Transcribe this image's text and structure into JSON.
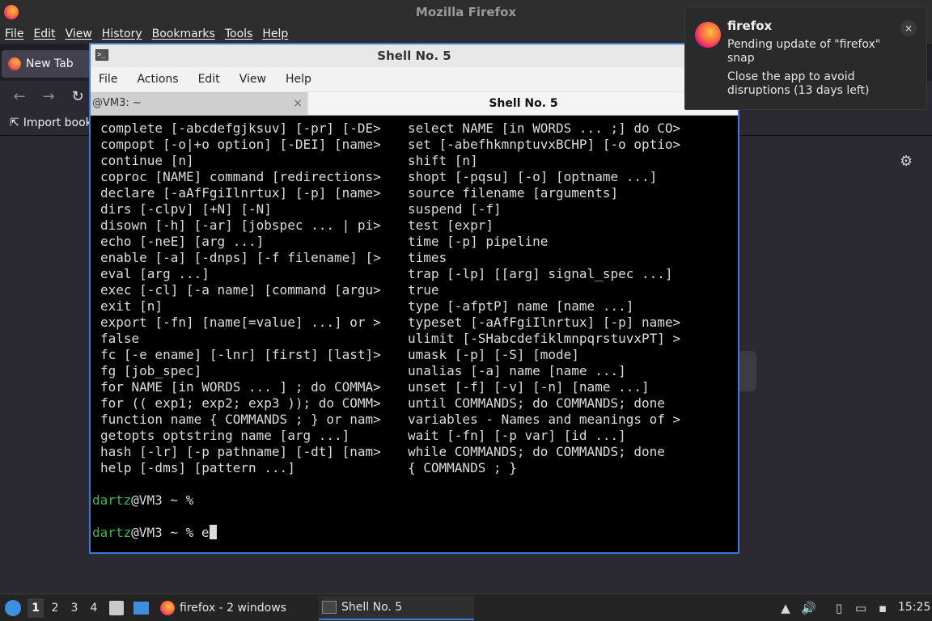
{
  "firefox": {
    "window_title": "Mozilla Firefox",
    "menu": [
      "File",
      "Edit",
      "View",
      "History",
      "Bookmarks",
      "Tools",
      "Help"
    ],
    "tab_label": "New Tab",
    "bookmark_import": "Import bookm",
    "nav": {
      "back": "←",
      "forward": "→",
      "reload": "↻"
    }
  },
  "terminal": {
    "window_title": "Shell No. 5",
    "menu": [
      "File",
      "Actions",
      "Edit",
      "View",
      "Help"
    ],
    "tabs": [
      {
        "label": "@VM3: ~",
        "close": "×"
      },
      {
        "label": "Shell No. 5"
      }
    ],
    "left_column": [
      "complete [-abcdefgjksuv] [-pr] [-DE>",
      "compopt [-o|+o option] [-DEI] [name>",
      "continue [n]",
      "coproc [NAME] command [redirections>",
      "declare [-aAfFgiIlnrtux] [-p] [name>",
      "dirs [-clpv] [+N] [-N]",
      "disown [-h] [-ar] [jobspec ... | pi>",
      "echo [-neE] [arg ...]",
      "enable [-a] [-dnps] [-f filename] [>",
      "eval [arg ...]",
      "exec [-cl] [-a name] [command [argu>",
      "exit [n]",
      "export [-fn] [name[=value] ...] or >",
      "false",
      "fc [-e ename] [-lnr] [first] [last]>",
      "fg [job_spec]",
      "for NAME [in WORDS ... ] ; do COMMA>",
      "for (( exp1; exp2; exp3 )); do COMM>",
      "function name { COMMANDS ; } or nam>",
      "getopts optstring name [arg ...]",
      "hash [-lr] [-p pathname] [-dt] [nam>",
      "help [-dms] [pattern ...]"
    ],
    "right_column": [
      "select NAME [in WORDS ... ;] do CO>",
      "set [-abefhkmnptuvxBCHP] [-o optio>",
      "shift [n]",
      "shopt [-pqsu] [-o] [optname ...]",
      "source filename [arguments]",
      "suspend [-f]",
      "test [expr]",
      "time [-p] pipeline",
      "times",
      "trap [-lp] [[arg] signal_spec ...]",
      "true",
      "type [-afptP] name [name ...]",
      "typeset [-aAfFgiIlnrtux] [-p] name>",
      "ulimit [-SHabcdefiklmnpqrstuvxPT] >",
      "umask [-p] [-S] [mode]",
      "unalias [-a] name [name ...]",
      "unset [-f] [-v] [-n] [name ...]",
      "until COMMANDS; do COMMANDS; done",
      "variables - Names and meanings of >",
      "wait [-fn] [-p var] [id ...]",
      "while COMMANDS; do COMMANDS; done",
      "{ COMMANDS ; }"
    ],
    "prompt_user": "dartz",
    "prompt_rest": "@VM3 ~ % ",
    "typed_text": "e"
  },
  "notification": {
    "app": "firefox",
    "line1": "Pending update of \"firefox\" snap",
    "line2": "Close the app to avoid disruptions (13 days left)",
    "close": "×"
  },
  "taskbar": {
    "workspaces": [
      "1",
      "2",
      "3",
      "4"
    ],
    "active_workspace": "1",
    "task_firefox": "firefox - 2 windows",
    "task_shell": "Shell No. 5",
    "clock": "15:25"
  }
}
